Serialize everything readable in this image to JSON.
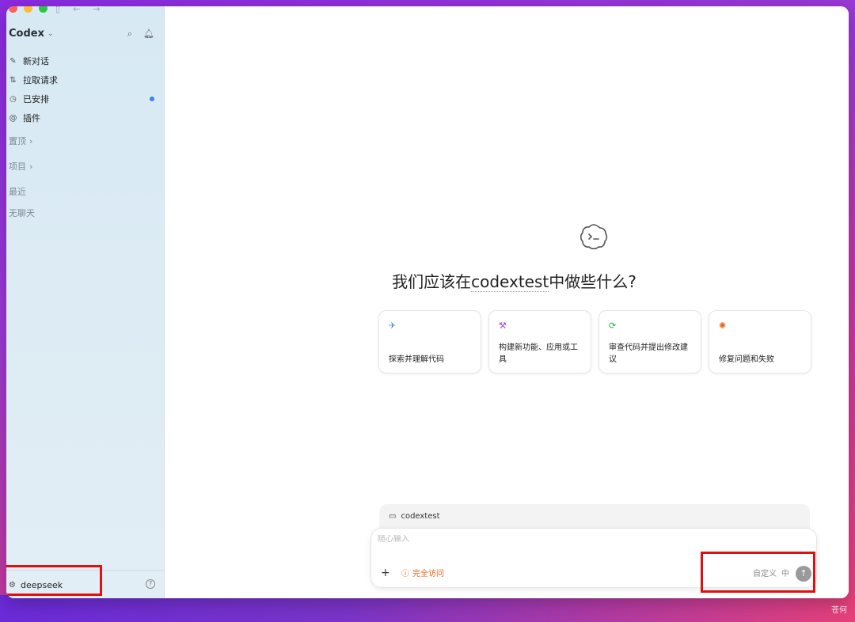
{
  "app": {
    "name": "Codex",
    "watermark": "苍何"
  },
  "sidebar": {
    "items": [
      {
        "label": "新对话",
        "icon": "edit-icon",
        "dot": false
      },
      {
        "label": "拉取请求",
        "icon": "pull-request-icon",
        "dot": false
      },
      {
        "label": "已安排",
        "icon": "clock-icon",
        "dot": true
      },
      {
        "label": "插件",
        "icon": "at-icon",
        "dot": false
      }
    ],
    "sections": {
      "pinned": "置顶",
      "projects": "项目",
      "recent": "最近",
      "empty": "无聊天"
    },
    "account": "deepseek"
  },
  "main": {
    "headline_prefix": "我们应该在",
    "headline_project": "codextest",
    "headline_suffix": "中做些什么?",
    "cards": [
      {
        "label": "探索并理解代码",
        "icon": "telescope-icon",
        "color": "#4a90e2"
      },
      {
        "label": "构建新功能、应用或工具",
        "icon": "hammer-icon",
        "color": "#9b4bd6"
      },
      {
        "label": "审查代码并提出修改建议",
        "icon": "review-icon",
        "color": "#2aa84a"
      },
      {
        "label": "修复问题和失败",
        "icon": "bug-icon",
        "color": "#e8651a"
      }
    ]
  },
  "composer": {
    "project": "codextest",
    "placeholder": "随心输入",
    "access_label": "完全访问",
    "access_color": "#e8651a",
    "mode_label": "自定义",
    "level_label": "中"
  }
}
